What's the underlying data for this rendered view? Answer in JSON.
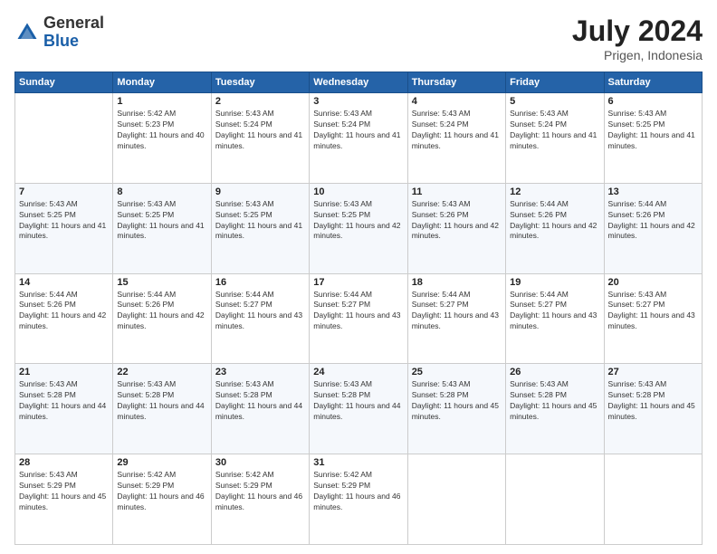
{
  "header": {
    "logo_general": "General",
    "logo_blue": "Blue",
    "month_year": "July 2024",
    "location": "Prigen, Indonesia"
  },
  "days_of_week": [
    "Sunday",
    "Monday",
    "Tuesday",
    "Wednesday",
    "Thursday",
    "Friday",
    "Saturday"
  ],
  "weeks": [
    [
      {
        "day": "",
        "sunrise": "",
        "sunset": "",
        "daylight": ""
      },
      {
        "day": "1",
        "sunrise": "Sunrise: 5:42 AM",
        "sunset": "Sunset: 5:23 PM",
        "daylight": "Daylight: 11 hours and 40 minutes."
      },
      {
        "day": "2",
        "sunrise": "Sunrise: 5:43 AM",
        "sunset": "Sunset: 5:24 PM",
        "daylight": "Daylight: 11 hours and 41 minutes."
      },
      {
        "day": "3",
        "sunrise": "Sunrise: 5:43 AM",
        "sunset": "Sunset: 5:24 PM",
        "daylight": "Daylight: 11 hours and 41 minutes."
      },
      {
        "day": "4",
        "sunrise": "Sunrise: 5:43 AM",
        "sunset": "Sunset: 5:24 PM",
        "daylight": "Daylight: 11 hours and 41 minutes."
      },
      {
        "day": "5",
        "sunrise": "Sunrise: 5:43 AM",
        "sunset": "Sunset: 5:24 PM",
        "daylight": "Daylight: 11 hours and 41 minutes."
      },
      {
        "day": "6",
        "sunrise": "Sunrise: 5:43 AM",
        "sunset": "Sunset: 5:25 PM",
        "daylight": "Daylight: 11 hours and 41 minutes."
      }
    ],
    [
      {
        "day": "7",
        "sunrise": "Sunrise: 5:43 AM",
        "sunset": "Sunset: 5:25 PM",
        "daylight": "Daylight: 11 hours and 41 minutes."
      },
      {
        "day": "8",
        "sunrise": "Sunrise: 5:43 AM",
        "sunset": "Sunset: 5:25 PM",
        "daylight": "Daylight: 11 hours and 41 minutes."
      },
      {
        "day": "9",
        "sunrise": "Sunrise: 5:43 AM",
        "sunset": "Sunset: 5:25 PM",
        "daylight": "Daylight: 11 hours and 41 minutes."
      },
      {
        "day": "10",
        "sunrise": "Sunrise: 5:43 AM",
        "sunset": "Sunset: 5:25 PM",
        "daylight": "Daylight: 11 hours and 42 minutes."
      },
      {
        "day": "11",
        "sunrise": "Sunrise: 5:43 AM",
        "sunset": "Sunset: 5:26 PM",
        "daylight": "Daylight: 11 hours and 42 minutes."
      },
      {
        "day": "12",
        "sunrise": "Sunrise: 5:44 AM",
        "sunset": "Sunset: 5:26 PM",
        "daylight": "Daylight: 11 hours and 42 minutes."
      },
      {
        "day": "13",
        "sunrise": "Sunrise: 5:44 AM",
        "sunset": "Sunset: 5:26 PM",
        "daylight": "Daylight: 11 hours and 42 minutes."
      }
    ],
    [
      {
        "day": "14",
        "sunrise": "Sunrise: 5:44 AM",
        "sunset": "Sunset: 5:26 PM",
        "daylight": "Daylight: 11 hours and 42 minutes."
      },
      {
        "day": "15",
        "sunrise": "Sunrise: 5:44 AM",
        "sunset": "Sunset: 5:26 PM",
        "daylight": "Daylight: 11 hours and 42 minutes."
      },
      {
        "day": "16",
        "sunrise": "Sunrise: 5:44 AM",
        "sunset": "Sunset: 5:27 PM",
        "daylight": "Daylight: 11 hours and 43 minutes."
      },
      {
        "day": "17",
        "sunrise": "Sunrise: 5:44 AM",
        "sunset": "Sunset: 5:27 PM",
        "daylight": "Daylight: 11 hours and 43 minutes."
      },
      {
        "day": "18",
        "sunrise": "Sunrise: 5:44 AM",
        "sunset": "Sunset: 5:27 PM",
        "daylight": "Daylight: 11 hours and 43 minutes."
      },
      {
        "day": "19",
        "sunrise": "Sunrise: 5:44 AM",
        "sunset": "Sunset: 5:27 PM",
        "daylight": "Daylight: 11 hours and 43 minutes."
      },
      {
        "day": "20",
        "sunrise": "Sunrise: 5:43 AM",
        "sunset": "Sunset: 5:27 PM",
        "daylight": "Daylight: 11 hours and 43 minutes."
      }
    ],
    [
      {
        "day": "21",
        "sunrise": "Sunrise: 5:43 AM",
        "sunset": "Sunset: 5:28 PM",
        "daylight": "Daylight: 11 hours and 44 minutes."
      },
      {
        "day": "22",
        "sunrise": "Sunrise: 5:43 AM",
        "sunset": "Sunset: 5:28 PM",
        "daylight": "Daylight: 11 hours and 44 minutes."
      },
      {
        "day": "23",
        "sunrise": "Sunrise: 5:43 AM",
        "sunset": "Sunset: 5:28 PM",
        "daylight": "Daylight: 11 hours and 44 minutes."
      },
      {
        "day": "24",
        "sunrise": "Sunrise: 5:43 AM",
        "sunset": "Sunset: 5:28 PM",
        "daylight": "Daylight: 11 hours and 44 minutes."
      },
      {
        "day": "25",
        "sunrise": "Sunrise: 5:43 AM",
        "sunset": "Sunset: 5:28 PM",
        "daylight": "Daylight: 11 hours and 45 minutes."
      },
      {
        "day": "26",
        "sunrise": "Sunrise: 5:43 AM",
        "sunset": "Sunset: 5:28 PM",
        "daylight": "Daylight: 11 hours and 45 minutes."
      },
      {
        "day": "27",
        "sunrise": "Sunrise: 5:43 AM",
        "sunset": "Sunset: 5:28 PM",
        "daylight": "Daylight: 11 hours and 45 minutes."
      }
    ],
    [
      {
        "day": "28",
        "sunrise": "Sunrise: 5:43 AM",
        "sunset": "Sunset: 5:29 PM",
        "daylight": "Daylight: 11 hours and 45 minutes."
      },
      {
        "day": "29",
        "sunrise": "Sunrise: 5:42 AM",
        "sunset": "Sunset: 5:29 PM",
        "daylight": "Daylight: 11 hours and 46 minutes."
      },
      {
        "day": "30",
        "sunrise": "Sunrise: 5:42 AM",
        "sunset": "Sunset: 5:29 PM",
        "daylight": "Daylight: 11 hours and 46 minutes."
      },
      {
        "day": "31",
        "sunrise": "Sunrise: 5:42 AM",
        "sunset": "Sunset: 5:29 PM",
        "daylight": "Daylight: 11 hours and 46 minutes."
      },
      {
        "day": "",
        "sunrise": "",
        "sunset": "",
        "daylight": ""
      },
      {
        "day": "",
        "sunrise": "",
        "sunset": "",
        "daylight": ""
      },
      {
        "day": "",
        "sunrise": "",
        "sunset": "",
        "daylight": ""
      }
    ]
  ]
}
